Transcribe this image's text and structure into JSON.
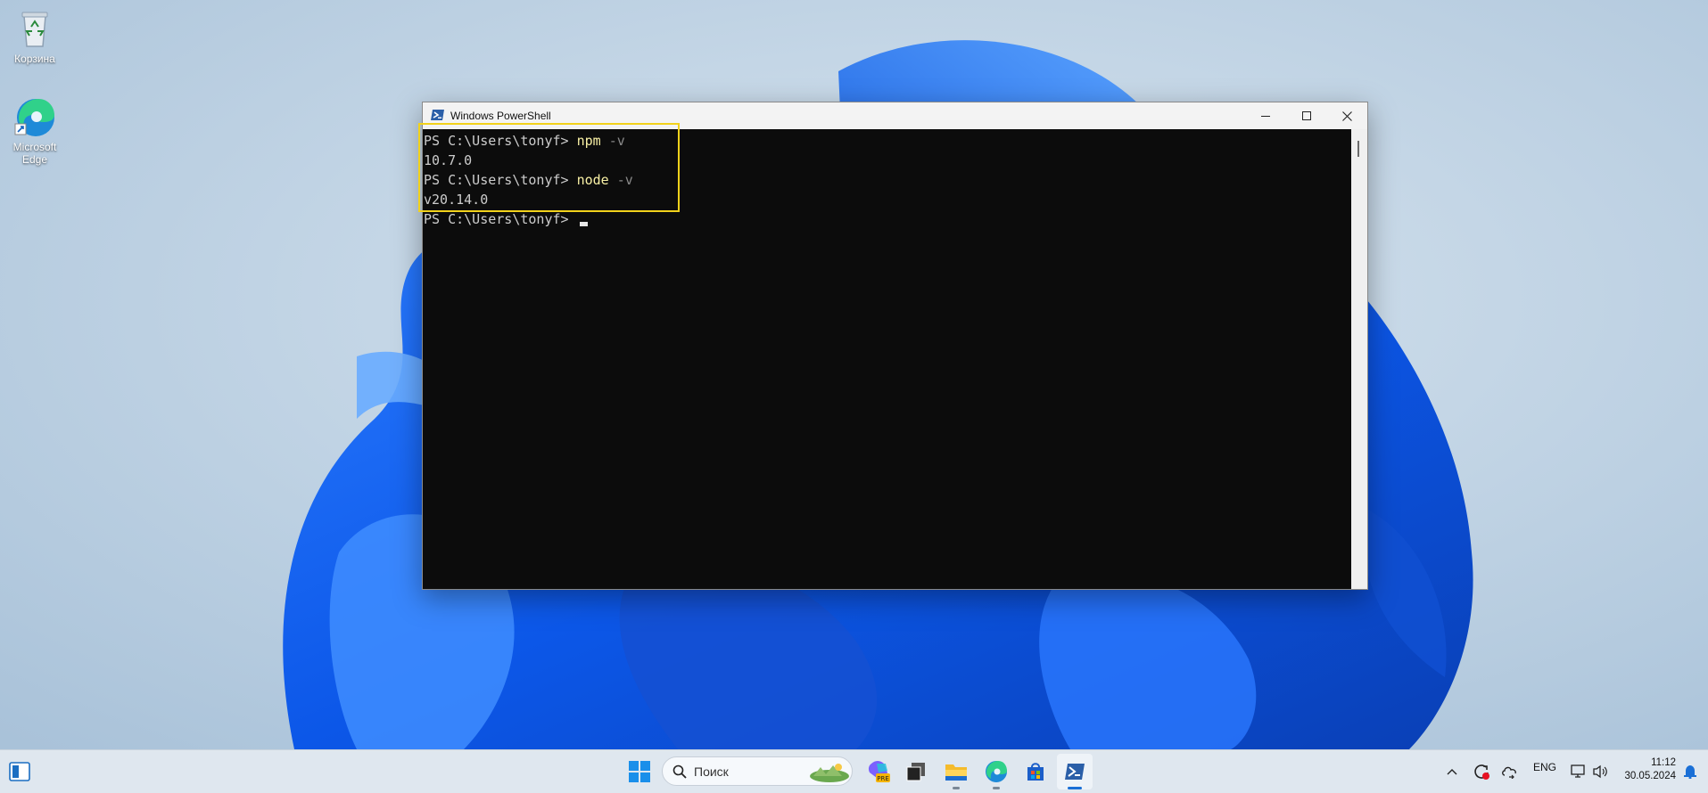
{
  "desktop": {
    "icons": [
      {
        "label": "Корзина"
      },
      {
        "label": "Microsoft Edge"
      }
    ]
  },
  "window": {
    "title": "Windows PowerShell",
    "console": [
      {
        "prompt": "PS C:\\Users\\tonyf> ",
        "command": "npm",
        "param": " -v"
      },
      {
        "output": "10.7.0"
      },
      {
        "prompt": "PS C:\\Users\\tonyf> ",
        "command": "node",
        "param": " -v"
      },
      {
        "output": "v20.14.0"
      },
      {
        "prompt": "PS C:\\Users\\tonyf> "
      }
    ]
  },
  "taskbar": {
    "search_placeholder": "Поиск",
    "language": "ENG",
    "time": "11:12",
    "date": "30.05.2024",
    "icons": [
      "widgets-icon",
      "start-icon",
      "search-icon",
      "copilot-icon",
      "task-view-icon",
      "file-explorer-icon",
      "edge-icon",
      "store-icon",
      "powershell-icon"
    ]
  },
  "colors": {
    "highlight": "#f2d21b",
    "console_bg": "#0c0c0c",
    "command": "#f9f1a5",
    "param": "#8a8a8a"
  }
}
